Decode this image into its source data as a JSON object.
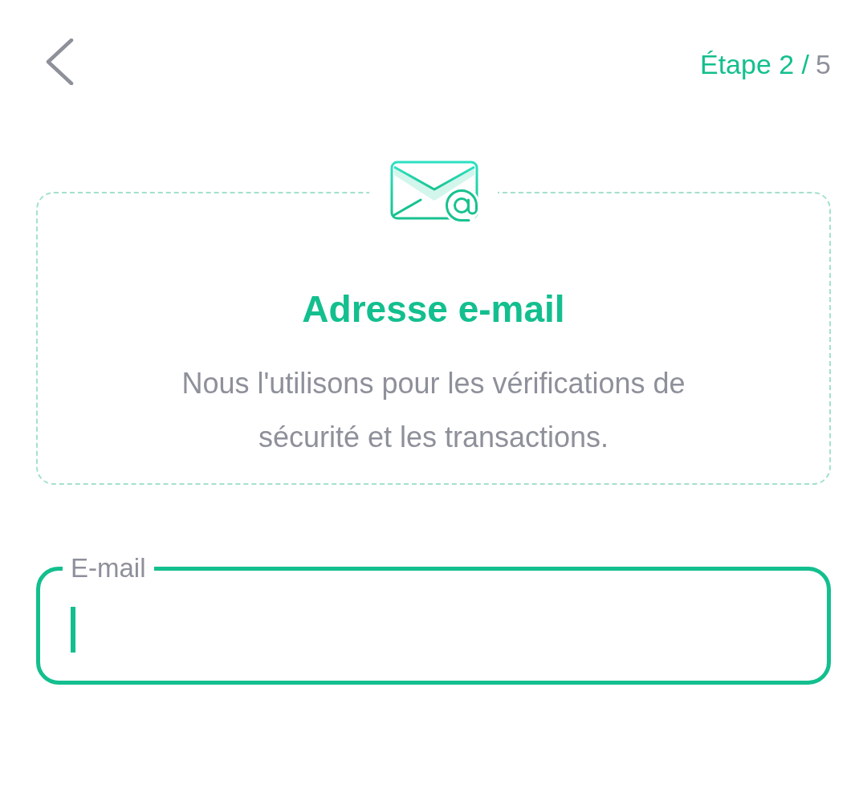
{
  "header": {
    "step": {
      "label": "Étape 2 /",
      "total": "5"
    }
  },
  "info_card": {
    "title": "Adresse e-mail",
    "description": "Nous l'utilisons pour les vérifications de sécurité et les transactions."
  },
  "email_field": {
    "label": "E-mail",
    "focused": true
  }
}
